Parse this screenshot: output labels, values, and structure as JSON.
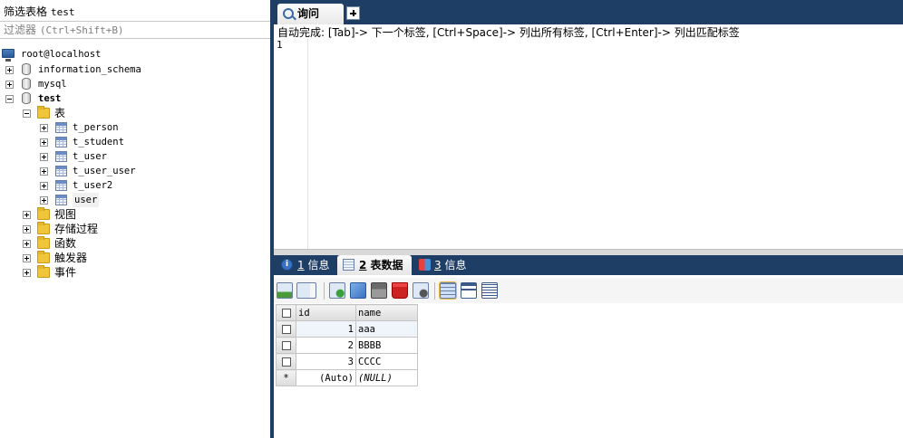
{
  "filter": {
    "label": "筛选表格",
    "value": "test",
    "placeholder_label": "过滤器",
    "placeholder_shortcut": "(Ctrl+Shift+B)"
  },
  "tree": {
    "root": "root@localhost",
    "databases": [
      "information_schema",
      "mysql",
      "test"
    ],
    "tables_folder": "表",
    "tables": [
      "t_person",
      "t_student",
      "t_user",
      "t_user_user",
      "t_user2",
      "user"
    ],
    "other_folders": [
      "视图",
      "存储过程",
      "函数",
      "触发器",
      "事件"
    ]
  },
  "query_tab": {
    "label": "询问"
  },
  "autocomplete_hint": "自动完成: [Tab]-> 下一个标签, [Ctrl+Space]-> 列出所有标签, [Ctrl+Enter]-> 列出匹配标签",
  "editor": {
    "line_number": "1"
  },
  "result_tabs": [
    {
      "num": "1",
      "label": "信息",
      "icon": "info-icon"
    },
    {
      "num": "2",
      "label": "表数据",
      "icon": "table-data-icon"
    },
    {
      "num": "3",
      "label": "信息",
      "icon": "messages-icon"
    }
  ],
  "toolbar_icons": [
    "insert-row-icon",
    "import-dropdown-icon",
    "add-row-icon",
    "duplicate-row-icon",
    "save-icon",
    "delete-icon",
    "cancel-icon",
    "grid-view-icon",
    "form-view-icon",
    "text-view-icon"
  ],
  "grid": {
    "columns": [
      "id",
      "name"
    ],
    "rows": [
      {
        "id": "1",
        "name": "aaa"
      },
      {
        "id": "2",
        "name": "BBBB"
      },
      {
        "id": "3",
        "name": "CCCC"
      }
    ],
    "new_row": {
      "marker": "*",
      "id": "(Auto)",
      "name": "(NULL)"
    }
  }
}
